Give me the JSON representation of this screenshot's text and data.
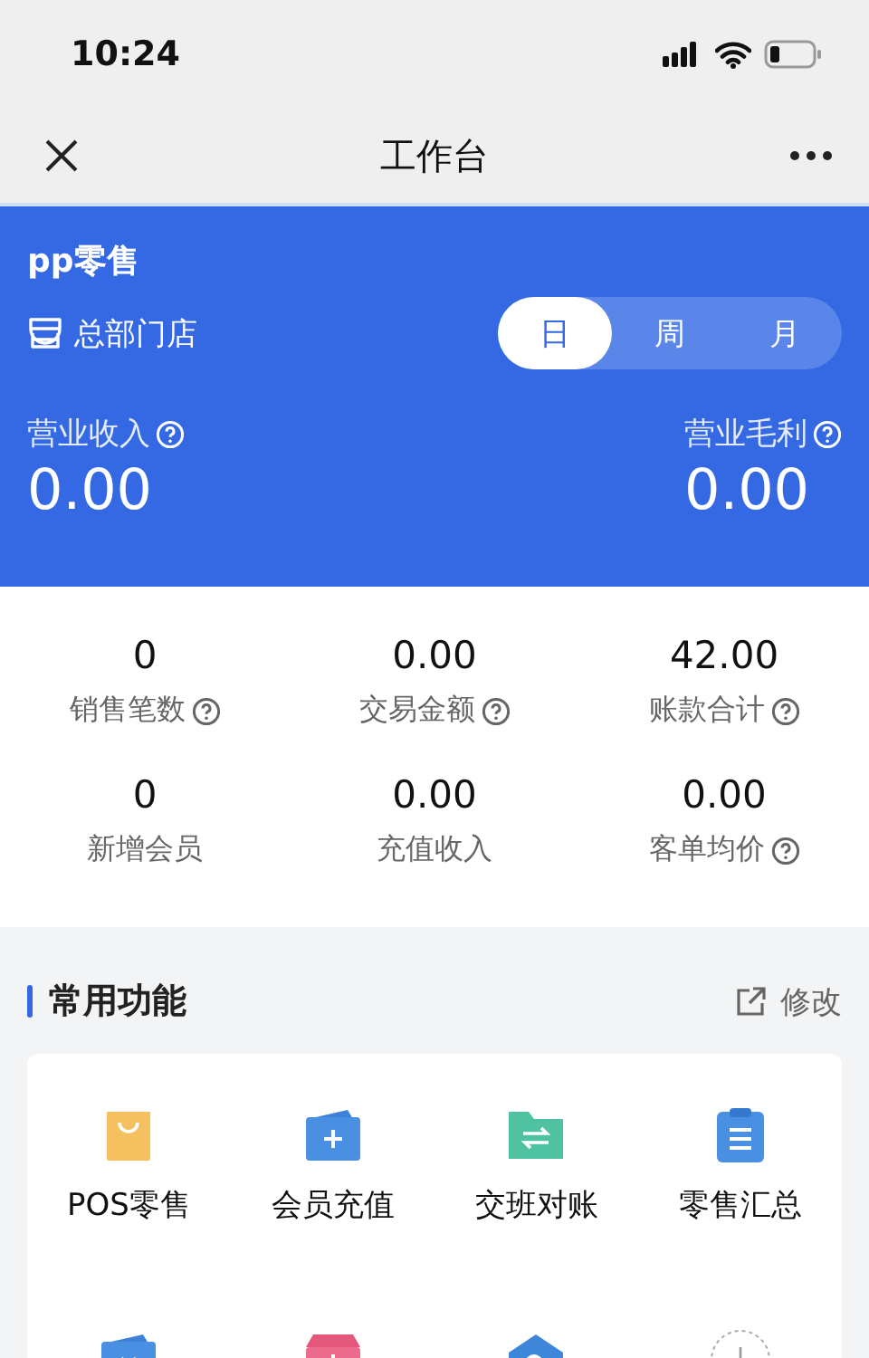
{
  "status_bar": {
    "time": "10:24"
  },
  "nav": {
    "title": "工作台"
  },
  "header": {
    "app_name": "pp零售",
    "store": "总部门店",
    "periods": [
      {
        "label": "日",
        "selected": true
      },
      {
        "label": "周",
        "selected": false
      },
      {
        "label": "月",
        "selected": false
      }
    ],
    "metrics": [
      {
        "label": "营业收入",
        "value": "0.00",
        "help": true
      },
      {
        "label": "营业毛利",
        "value": "0.00",
        "help": true
      }
    ]
  },
  "stats": [
    {
      "value": "0",
      "label": "销售笔数",
      "help": true
    },
    {
      "value": "0.00",
      "label": "交易金额",
      "help": true
    },
    {
      "value": "42.00",
      "label": "账款合计",
      "help": true
    },
    {
      "value": "0",
      "label": "新增会员",
      "help": false
    },
    {
      "value": "0.00",
      "label": "充值收入",
      "help": false
    },
    {
      "value": "0.00",
      "label": "客单均价",
      "help": true
    }
  ],
  "functions": {
    "title": "常用功能",
    "edit_label": "修改",
    "items": [
      {
        "kind": "function",
        "label": "POS零售"
      },
      {
        "kind": "function",
        "label": "会员充值"
      },
      {
        "kind": "function",
        "label": "交班对账"
      },
      {
        "kind": "function",
        "label": "零售汇总"
      },
      {
        "kind": "function"
      },
      {
        "kind": "function"
      },
      {
        "kind": "function"
      },
      {
        "kind": "add"
      }
    ]
  }
}
